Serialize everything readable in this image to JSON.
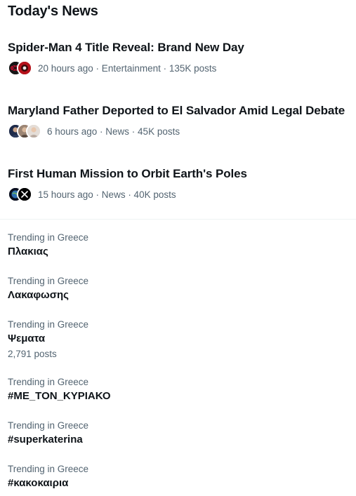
{
  "section": {
    "title": "Today's News"
  },
  "news": [
    {
      "headline": "Spider-Man 4 Title Reveal: Brand New Day",
      "meta": "20 hours ago · Entertainment · 135K posts",
      "avatars": [
        "spiderman-logo-icon",
        "marvel-avatar-icon"
      ]
    },
    {
      "headline": "Maryland Father Deported to El Salvador Amid Legal Debate",
      "meta": "6 hours ago · News · 45K posts",
      "avatars": [
        "person-avatar-icon",
        "person-avatar-icon",
        "person-avatar-icon"
      ]
    },
    {
      "headline": "First Human Mission to Orbit Earth's Poles",
      "meta": "15 hours ago · News · 40K posts",
      "avatars": [
        "globe-avatar-icon",
        "x-logo-icon"
      ]
    }
  ],
  "trends": [
    {
      "context": "Trending in Greece",
      "name": "Πλακιας",
      "count": ""
    },
    {
      "context": "Trending in Greece",
      "name": "Λακαφωσης",
      "count": ""
    },
    {
      "context": "Trending in Greece",
      "name": "Ψεματα",
      "count": "2,791 posts"
    },
    {
      "context": "Trending in Greece",
      "name": "#ΜΕ_ΤΟΝ_ΚΥΡΙΑΚΟ",
      "count": ""
    },
    {
      "context": "Trending in Greece",
      "name": "#superkaterina",
      "count": ""
    },
    {
      "context": "Trending in Greece",
      "name": "#κακοκαιρια",
      "count": ""
    }
  ],
  "colors": {
    "text_primary": "#0f1419",
    "text_secondary": "#536471",
    "divider": "#eff3f4"
  }
}
